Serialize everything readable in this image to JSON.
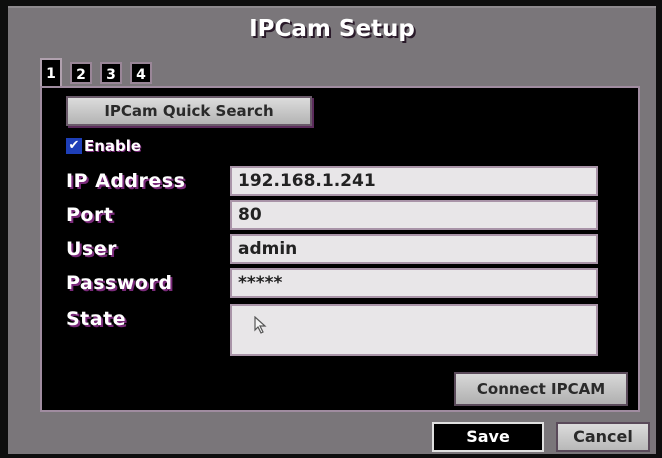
{
  "window": {
    "title": "IPCam Setup"
  },
  "tabs": [
    {
      "label": "1",
      "active": true
    },
    {
      "label": "2",
      "active": false
    },
    {
      "label": "3",
      "active": false
    },
    {
      "label": "4",
      "active": false
    }
  ],
  "quick_search_label": "IPCam Quick Search",
  "enable": {
    "label": "Enable",
    "checked": true
  },
  "fields": {
    "ip_address": {
      "label": "IP Address",
      "value": "192.168.1.241"
    },
    "port": {
      "label": "Port",
      "value": "80"
    },
    "user": {
      "label": "User",
      "value": "admin"
    },
    "password": {
      "label": "Password",
      "value": "*****"
    },
    "state": {
      "label": "State",
      "value": ""
    }
  },
  "connect_label": "Connect IPCAM",
  "save_label": "Save",
  "cancel_label": "Cancel",
  "icons": {
    "checkbox": "check-icon",
    "pointer": "mouse-pointer-icon"
  },
  "colors": {
    "frame": "#7a767a",
    "panel": "#000000",
    "checkbox": "#1e3fb8",
    "label_shadow": "#7a2a7a"
  }
}
